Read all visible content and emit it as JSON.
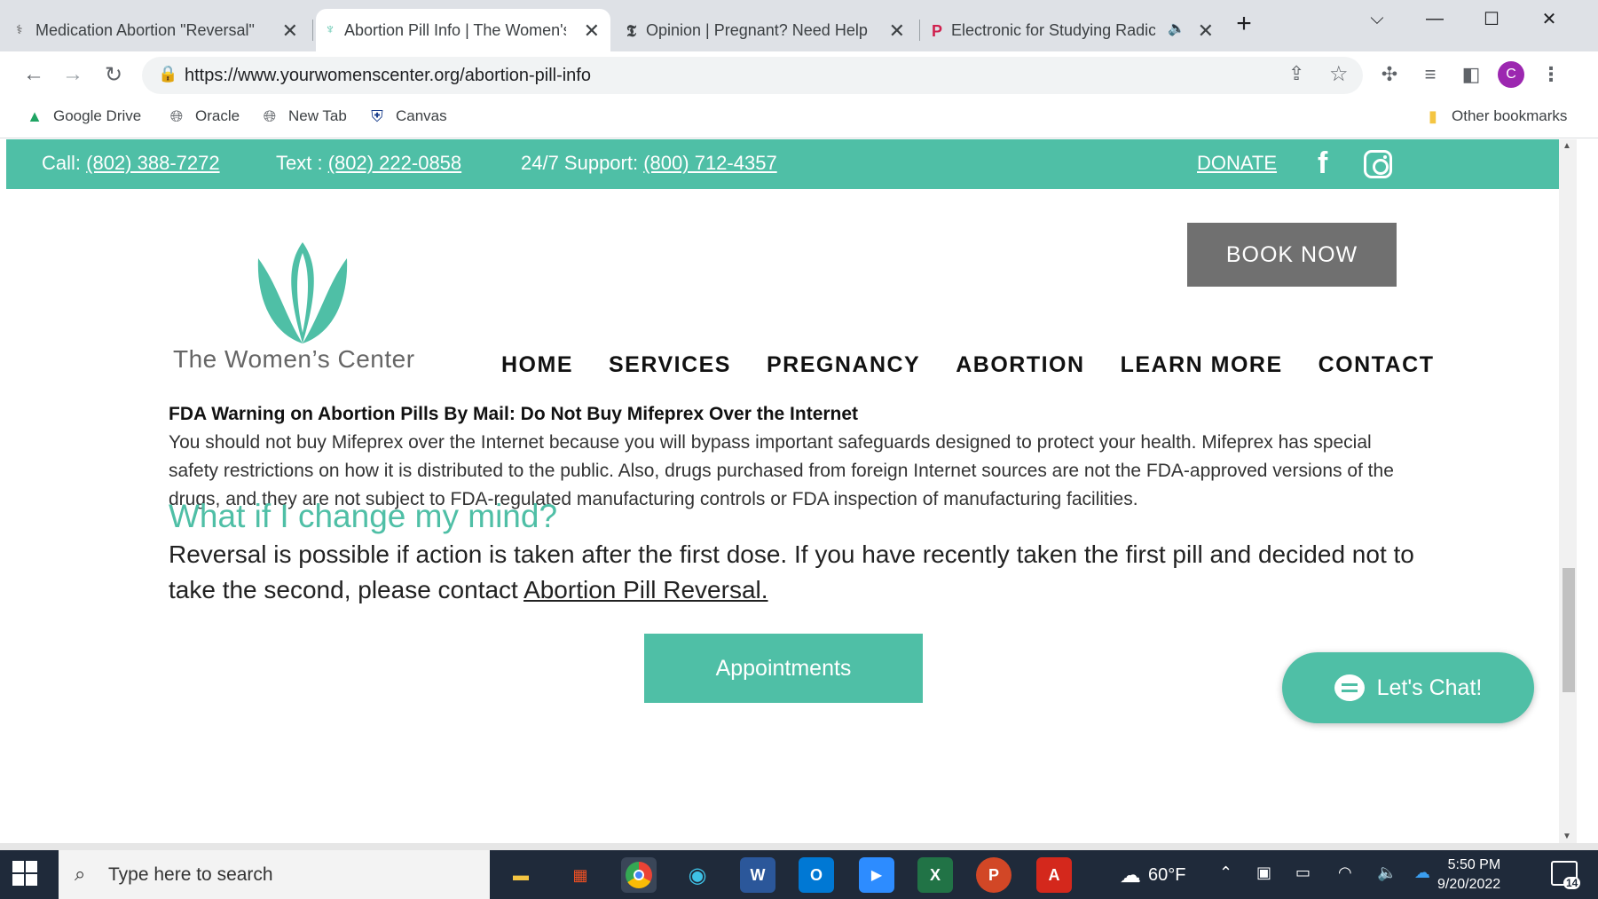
{
  "browser": {
    "tabs": [
      {
        "title": "Medication Abortion \"Reversal\" I",
        "active": false
      },
      {
        "title": "Abortion Pill Info | The Women's",
        "active": true
      },
      {
        "title": "Opinion | Pregnant? Need Help?",
        "active": false
      },
      {
        "title": "Electronic for Studying Radic",
        "active": false
      }
    ],
    "url": "https://www.yourwomenscenter.org/abortion-pill-info",
    "avatar_letter": "C",
    "bookmarks": [
      "Google Drive",
      "Oracle",
      "New Tab",
      "Canvas"
    ],
    "other_bookmarks": "Other bookmarks"
  },
  "site": {
    "topbar": {
      "call_label": "Call:",
      "call_number": "(802) 388-7272",
      "text_label": "Text :",
      "text_number": "(802) 222-0858",
      "support_label": "24/7 Support:",
      "support_number": "(800) 712-4357",
      "donate": "DONATE"
    },
    "logo_text": "The Women’s Center",
    "book_now": "BOOK NOW",
    "nav": [
      "HOME",
      "SERVICES",
      "PREGNANCY",
      "ABORTION",
      "LEARN MORE",
      "CONTACT"
    ],
    "fda_heading": "FDA Warning on Abortion Pills By Mail: Do Not Buy Mifeprex Over the Internet",
    "fda_body": "You should not buy Mifeprex over the Internet because you will bypass important safeguards designed to protect your health. Mifeprex has special safety restrictions on how it is distributed to the public. Also, drugs purchased from foreign Internet sources are not the FDA-approved versions of the drugs, and they are not subject to FDA-regulated manufacturing controls or FDA inspection of manufacturing facilities.",
    "question": "What if I change my mind?",
    "reversal_text": "Reversal is possible if action is taken after the first dose. If you have recently taken the first pill and decided not to take the second, please contact ",
    "reversal_link": "Abortion Pill Reversal.",
    "appointments": "Appointments",
    "chat": "Let's Chat!",
    "accent_color": "#4fbfa6"
  },
  "taskbar": {
    "search_placeholder": "Type here to search",
    "weather": "60°F",
    "time": "5:50 PM",
    "date": "9/20/2022",
    "notifications": "14"
  }
}
